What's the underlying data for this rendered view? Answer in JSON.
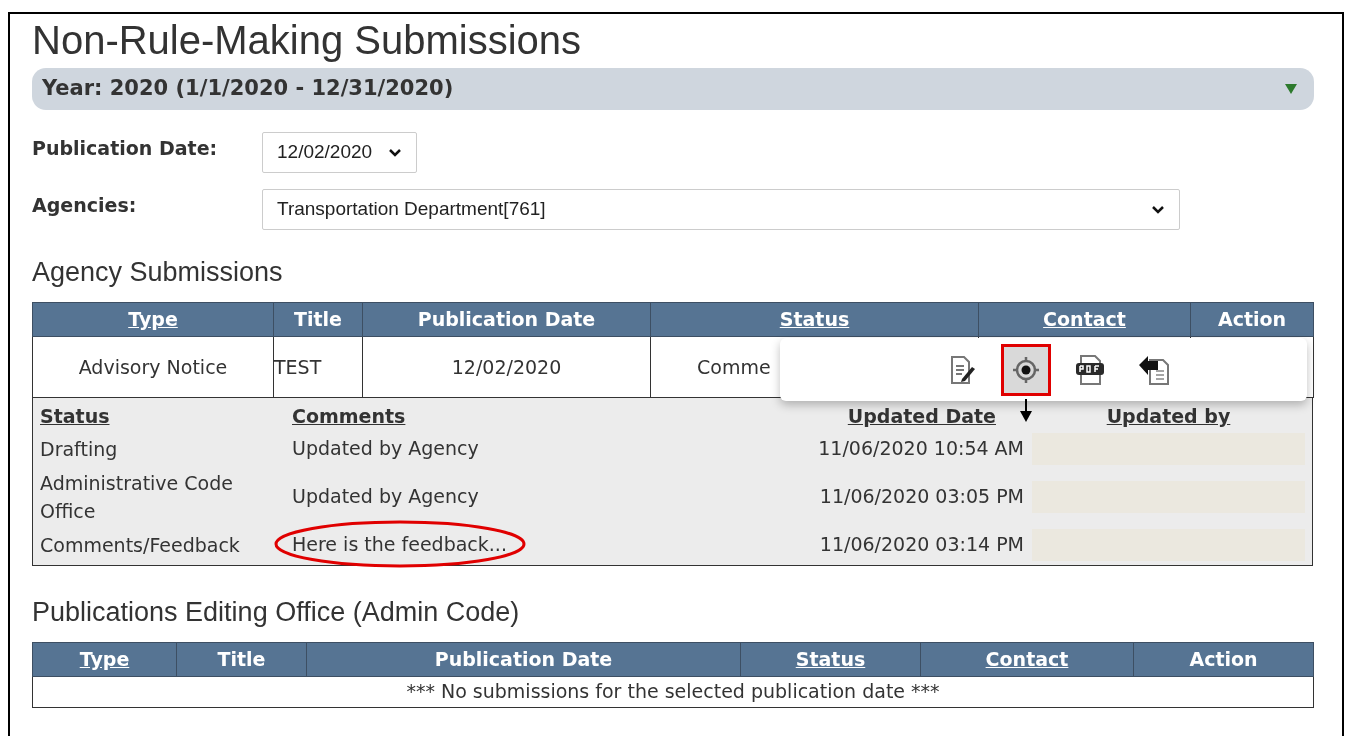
{
  "page": {
    "title": "Non-Rule-Making Submissions"
  },
  "year_bar": {
    "label": "Year: 2020 (1/1/2020 - 12/31/2020)",
    "expanded": true
  },
  "filters": [
    {
      "label": "Publication Date:",
      "value": "12/02/2020"
    },
    {
      "label": "Agencies:",
      "value": "Transportation Department[761]"
    }
  ],
  "agency_submissions": {
    "heading": "Agency Submissions",
    "columns": [
      {
        "label": "Type",
        "link": true
      },
      {
        "label": "Title",
        "link": false
      },
      {
        "label": "Publication Date",
        "link": false
      },
      {
        "label": "Status",
        "link": true
      },
      {
        "label": "Contact",
        "link": true
      },
      {
        "label": "Action",
        "link": false
      }
    ],
    "rows": [
      {
        "type": "Advisory Notice",
        "title": "TEST",
        "publication_date": "12/02/2020",
        "status": "Comme"
      }
    ],
    "history": {
      "columns": [
        {
          "label": "Status"
        },
        {
          "label": "Comments"
        },
        {
          "label": "Updated Date"
        },
        {
          "label": "Updated by"
        }
      ],
      "rows": [
        {
          "status": "Drafting",
          "comments": "Updated by Agency",
          "updated_date": "11/06/2020 10:54 AM",
          "circled": false
        },
        {
          "status": "Administrative Code Office",
          "comments": "Updated by Agency",
          "updated_date": "11/06/2020 03:05 PM",
          "circled": false
        },
        {
          "status": "Comments/Feedback",
          "comments": "Here is the feedback...",
          "updated_date": "11/06/2020 03:14 PM",
          "circled": true
        }
      ]
    },
    "action_menu": [
      {
        "kind": "edit",
        "highlighted": false
      },
      {
        "kind": "target",
        "highlighted": true
      },
      {
        "kind": "pdf",
        "highlighted": false
      },
      {
        "kind": "back",
        "highlighted": false
      }
    ]
  },
  "editing_office": {
    "heading": "Publications Editing Office (Admin Code)",
    "columns": [
      {
        "label": "Type",
        "link": true
      },
      {
        "label": "Title",
        "link": false
      },
      {
        "label": "Publication Date",
        "link": false
      },
      {
        "label": "Status",
        "link": true
      },
      {
        "label": "Contact",
        "link": true
      },
      {
        "label": "Action",
        "link": false
      }
    ],
    "empty_message": "*** No submissions for the selected publication date ***"
  }
}
